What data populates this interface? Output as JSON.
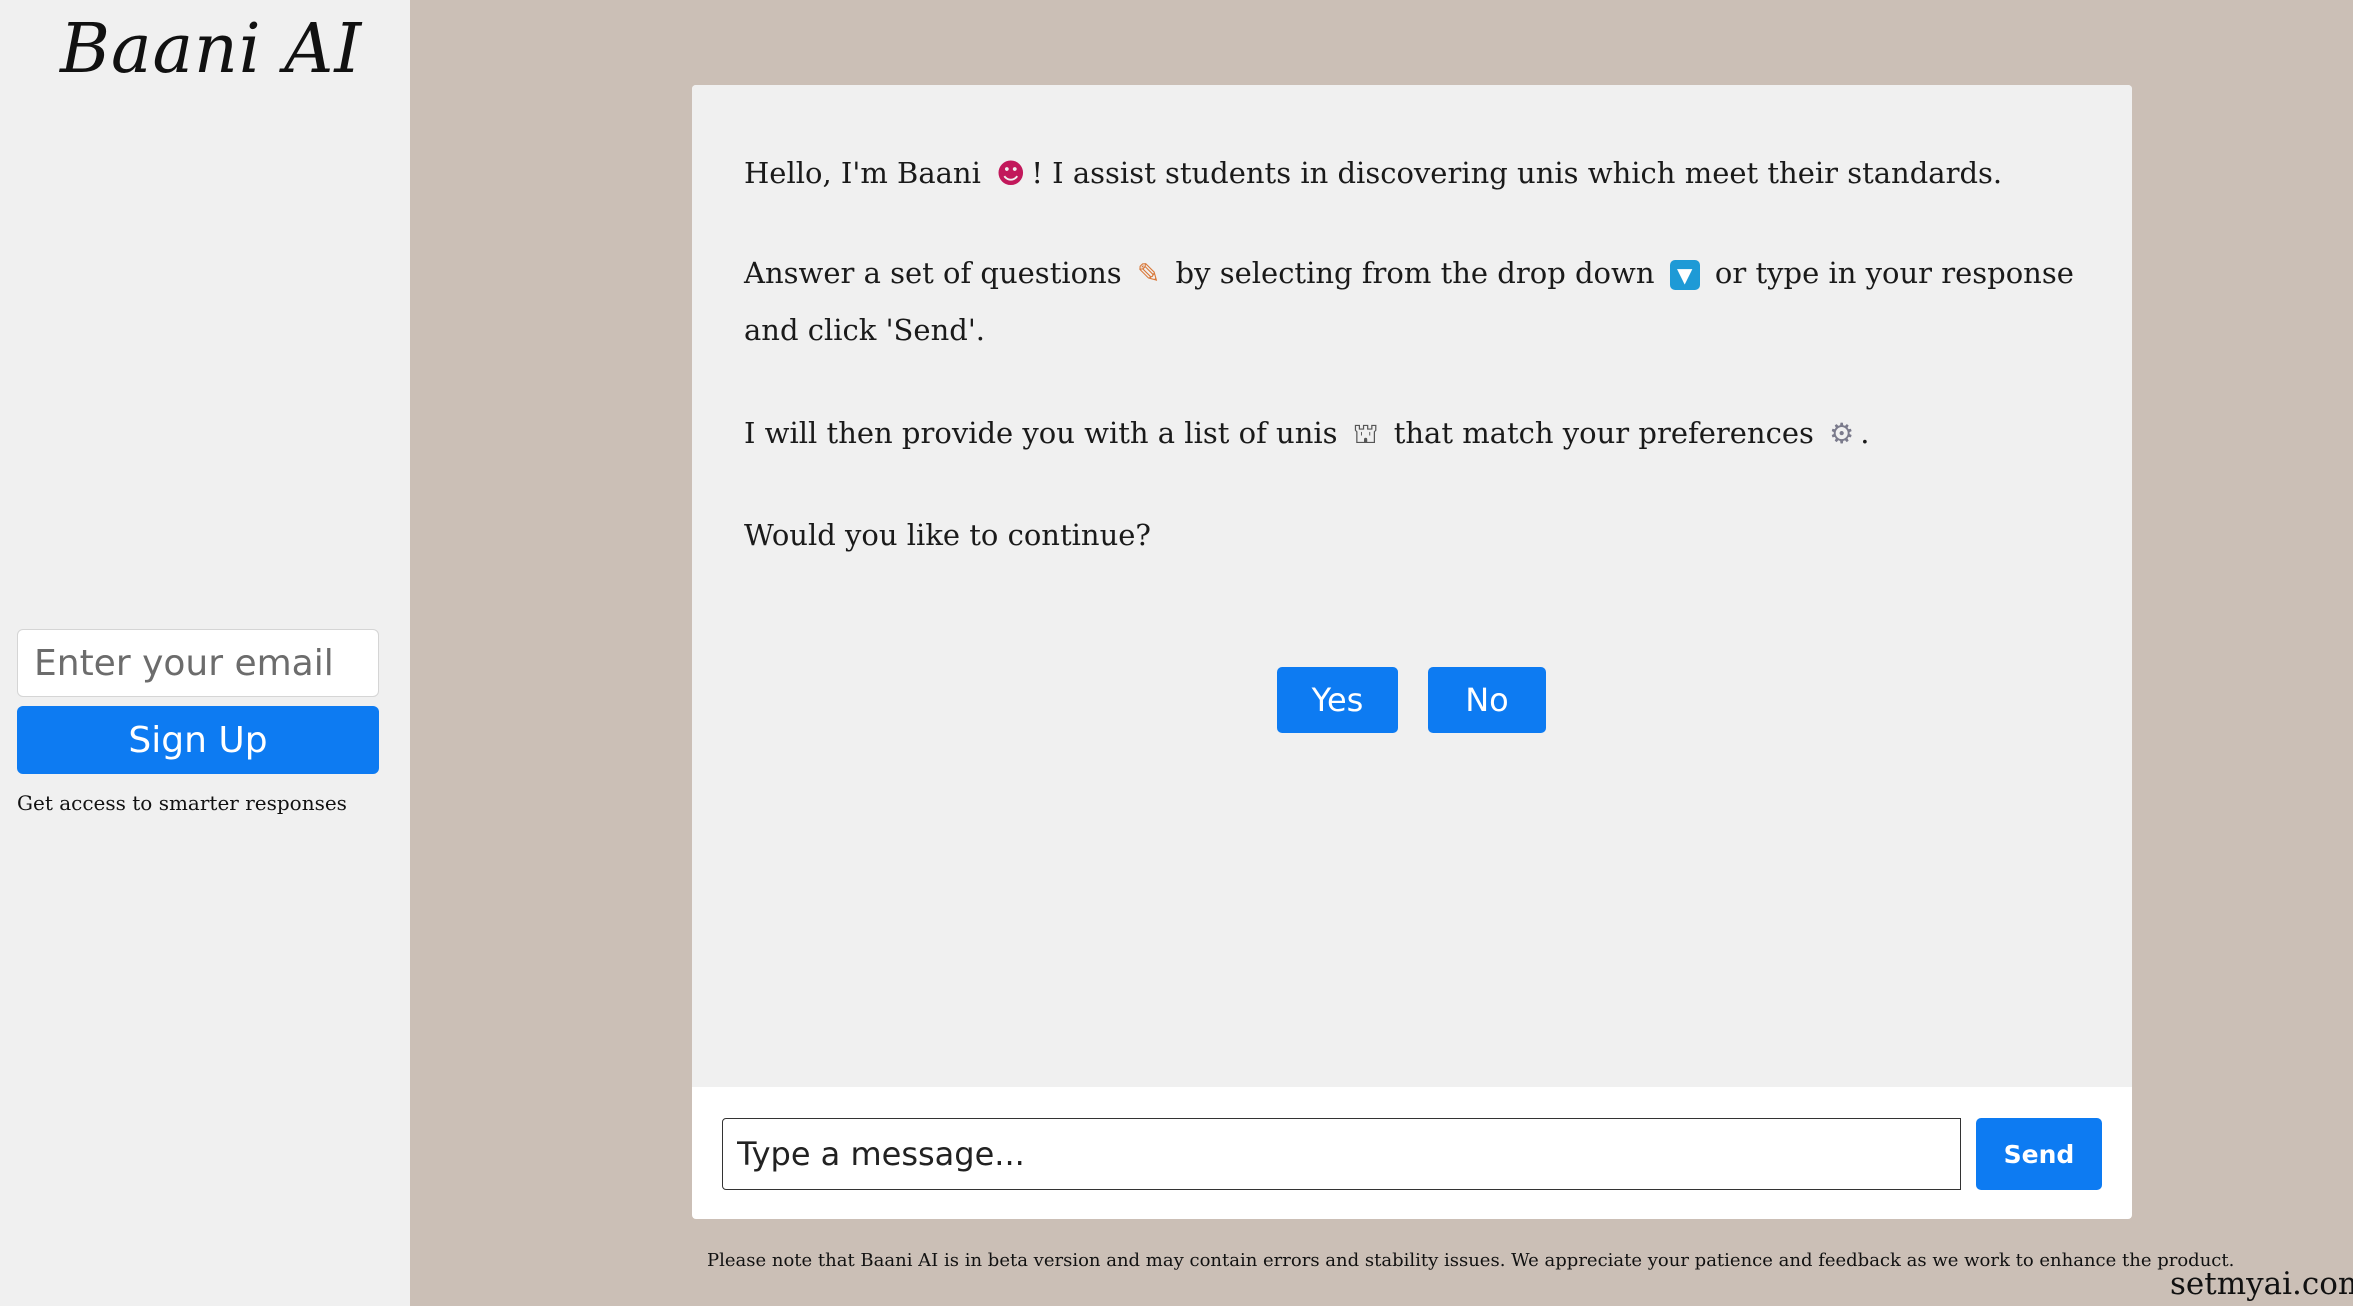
{
  "sidebar": {
    "logo": "Baani AI",
    "email_placeholder": "Enter your email",
    "signup_label": "Sign Up",
    "signup_note": "Get access to smarter responses"
  },
  "chat": {
    "messages": [
      {
        "p1": "Hello, I'm Baani ",
        "icon1": "robot-icon",
        "p2": "! I assist students in discovering unis which meet their standards."
      },
      {
        "p1": "Answer a set of questions ",
        "icon1": "memo-icon",
        "p2": " by selecting from the drop down ",
        "icon2": "down-arrow-button-icon",
        "p3": " or type in your response and click 'Send'."
      },
      {
        "p1": "I will then provide you with a list of unis ",
        "icon1": "classical-building-icon",
        "p2": " that match your preferences ",
        "icon2": "gear-icon",
        "p3": "."
      },
      {
        "p1": "Would you like to continue?"
      }
    ],
    "yes_label": "Yes",
    "no_label": "No",
    "input_placeholder": "Type a message...",
    "send_label": "Send"
  },
  "footer": {
    "beta_note": "Please note that Baani AI is in beta version and may contain errors and stability issues. We appreciate your patience and feedback as we work to enhance the product.",
    "watermark": "setmyai.com"
  },
  "colors": {
    "accent": "#0d7bf2",
    "page_background": "#cbbfb6",
    "panel_background": "#f0f0f0"
  }
}
